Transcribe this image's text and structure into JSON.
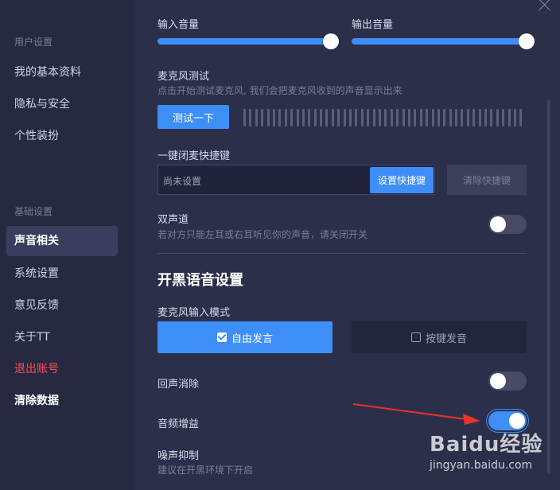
{
  "sidebar": {
    "section_user": "用户设置",
    "items_user": [
      "我的基本资料",
      "隐私与安全",
      "个性装扮"
    ],
    "section_basic": "基础设置",
    "items_basic": [
      "声音相关",
      "系统设置",
      "意见反馈",
      "关于TT"
    ],
    "logout": "退出账号",
    "clear_data": "清除数据",
    "active_item": "声音相关"
  },
  "audio": {
    "input_volume_label": "输入音量",
    "input_volume_value": 1.0,
    "output_volume_label": "输出音量",
    "output_volume_value": 1.0
  },
  "mic_test": {
    "title": "麦克风测试",
    "hint": "点击开始测试麦克风, 我们会把麦克风收到的声音显示出来",
    "button": "测试一下"
  },
  "mute_shortcut": {
    "title": "一键闭麦快捷键",
    "placeholder": "尚未设置",
    "set_button": "设置快捷键",
    "clear_button": "清除快捷键"
  },
  "stereo": {
    "title": "双声道",
    "hint": "若对方只能左耳或右耳听见你的声音，请关闭开关",
    "enabled": false
  },
  "voice_chat": {
    "section_title": "开黑语音设置",
    "mic_mode_label": "麦克风输入模式",
    "mode_free": "自由发言",
    "mode_ptt": "按键发音",
    "selected_mode": "自由发言",
    "echo_cancel_label": "回声消除",
    "echo_cancel_enabled": false,
    "gain_label": "音频增益",
    "gain_enabled": true,
    "noise_label": "噪声抑制",
    "noise_hint": "建议在开黑环境下开启"
  },
  "watermark": {
    "brand": "Baidu经验",
    "url": "jingyan.baidu.com"
  },
  "colors": {
    "accent": "#3e8ef7",
    "danger": "#ff4d5b",
    "arrow": "#e8322d"
  }
}
